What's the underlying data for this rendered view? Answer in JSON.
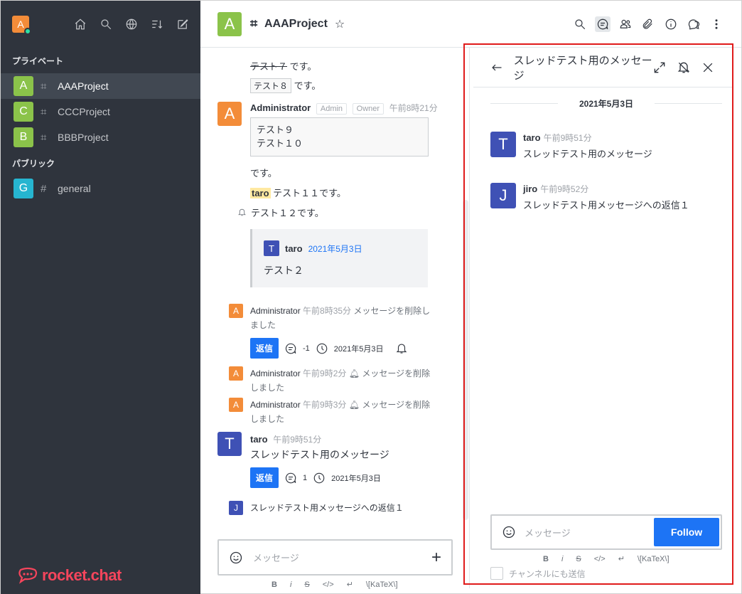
{
  "sidebar": {
    "user_initial": "A",
    "section_private": "プライベート",
    "section_public": "パブリック",
    "rooms_private": [
      {
        "initial": "A",
        "name": "AAAProject",
        "color": "#8bc34a"
      },
      {
        "initial": "C",
        "name": "CCCProject",
        "color": "#8bc34a"
      },
      {
        "initial": "B",
        "name": "BBBProject",
        "color": "#8bc34a"
      }
    ],
    "rooms_public": [
      {
        "initial": "G",
        "name": "general",
        "color": "#26b5d0"
      }
    ],
    "brand": "rocket.chat"
  },
  "header": {
    "room_initial": "A",
    "room_name": "AAAProject",
    "star": "☆"
  },
  "messages": {
    "m1": {
      "strike": "テスト７",
      "after": " です。"
    },
    "m2": {
      "code": "テスト８",
      "after": " です。"
    },
    "admin_block": {
      "initial": "A",
      "name": "Administrator",
      "role1": "Admin",
      "role2": "Owner",
      "time": "午前8時21分",
      "code_lines": [
        "テスト９",
        "テスト１０"
      ],
      "after_code": "です。",
      "mention": "taro",
      "mention_after": " テスト１１です。",
      "bell_text": "テスト１２です。"
    },
    "quote": {
      "initial": "T",
      "name": "taro",
      "date": "2021年5月3日",
      "text": "テスト２"
    },
    "sys1": {
      "initial": "A",
      "name": "Administrator",
      "time": "午前8時35分",
      "text": "メッセージを削除しました"
    },
    "thread1": {
      "reply": "返信",
      "count": "-1",
      "date": "2021年5月3日"
    },
    "sys2": {
      "initial": "A",
      "name": "Administrator",
      "time": "午前9時2分",
      "text": "メッセージを削除しました"
    },
    "sys3": {
      "initial": "A",
      "name": "Administrator",
      "time": "午前9時3分",
      "text": "メッセージを削除しました"
    },
    "taro_msg": {
      "initial": "T",
      "name": "taro",
      "time": "午前9時51分",
      "text": "スレッドテスト用のメッセージ"
    },
    "thread2": {
      "reply": "返信",
      "count": "1",
      "date": "2021年5月3日"
    },
    "reply_preview": {
      "initial": "J",
      "text": "スレッドテスト用メッセージへの返信１"
    }
  },
  "composer": {
    "placeholder": "メッセージ",
    "fmt": [
      "B",
      "i",
      "S",
      "</>",
      "↵",
      "\\[KaTeX\\]"
    ]
  },
  "thread_panel": {
    "title": "スレッドテスト用のメッセージ",
    "date": "2021年5月3日",
    "msgs": [
      {
        "initial": "T",
        "name": "taro",
        "time": "午前9時51分",
        "text": "スレッドテスト用のメッセージ"
      },
      {
        "initial": "J",
        "name": "jiro",
        "time": "午前9時52分",
        "text": "スレッドテスト用メッセージへの返信１"
      }
    ],
    "placeholder": "メッセージ",
    "follow": "Follow",
    "fmt": [
      "B",
      "i",
      "S",
      "</>",
      "↵",
      "\\[KaTeX\\]"
    ],
    "also_send": "チャンネルにも送信"
  }
}
